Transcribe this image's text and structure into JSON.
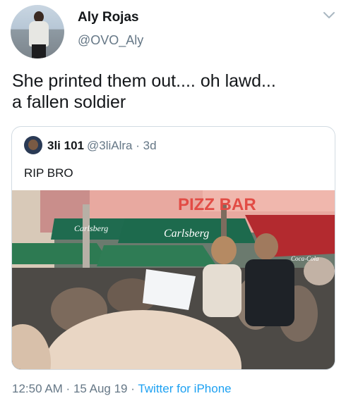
{
  "author": {
    "name": "Aly Rojas",
    "handle": "@OVO_Aly"
  },
  "tweet": {
    "text": "She printed them out.... oh lawd...\na fallen soldier"
  },
  "quoted": {
    "name": "3li 101",
    "handle": "@3liAlra",
    "time": "3d",
    "text": "RIP BRO",
    "photo_signs": {
      "pizza_bar": "PIZZ BAR",
      "carlsberg": "Carlsberg",
      "carlsberg_2": "Carlsberg",
      "cocacola": "Coca-Cola"
    }
  },
  "meta": {
    "time": "12:50 AM",
    "date": "15 Aug 19",
    "source": "Twitter for iPhone",
    "sep": " · "
  },
  "colors": {
    "text": "#14171a",
    "secondary": "#657786",
    "link": "#1da1f2",
    "border": "#d2dbe2"
  }
}
